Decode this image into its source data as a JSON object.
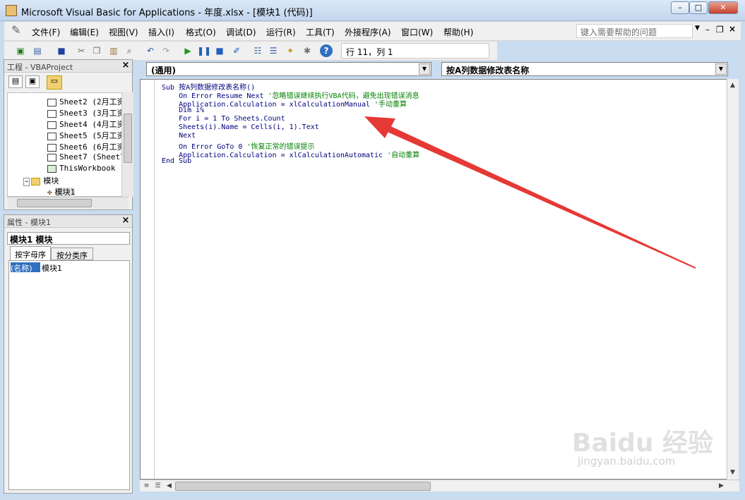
{
  "window": {
    "title": "Microsoft Visual Basic for Applications - 年度.xlsx - [模块1 (代码)]",
    "minimize": "–",
    "maximize": "□",
    "close": "✕"
  },
  "menu": {
    "items": [
      "文件(F)",
      "编辑(E)",
      "视图(V)",
      "插入(I)",
      "格式(O)",
      "调试(D)",
      "运行(R)",
      "工具(T)",
      "外接程序(A)",
      "窗口(W)",
      "帮助(H)"
    ],
    "help_placeholder": "键入需要帮助的问题"
  },
  "toolbar": {
    "position": "行 11，列 1"
  },
  "project": {
    "title": "工程 - VBAProject",
    "items": [
      "Sheet2 (2月工资",
      "Sheet3 (3月工资",
      "Sheet4 (4月工资",
      "Sheet5 (5月工资",
      "Sheet6 (6月工资",
      "Sheet7 (Sheet7",
      "ThisWorkbook"
    ],
    "folder": "模块",
    "module": "模块1"
  },
  "properties": {
    "title": "属性 - 模块1",
    "selector": "模块1 模块",
    "tab_alpha": "按字母序",
    "tab_cat": "按分类序",
    "prop_name": "(名称)",
    "prop_value": "模块1"
  },
  "editor": {
    "object_dropdown": "(通用)",
    "proc_dropdown": "按A列数据修改表名称",
    "lines": [
      {
        "code": "Sub 按A列数据修改表名称()",
        "comment": ""
      },
      {
        "code": "    On Error Resume Next ",
        "comment": "'忽略错误继续执行VBA代码，避免出现错误消息"
      },
      {
        "code": "    Application.Calculation = xlCalculationManual ",
        "comment": "'手动重算"
      },
      {
        "code": "    Dim i%",
        "comment": ""
      },
      {
        "code": "    For i = 1 To Sheets.Count",
        "comment": ""
      },
      {
        "code": "    Sheets(i).Name = Cells(i, 1).Text",
        "comment": ""
      },
      {
        "code": "    Next",
        "comment": ""
      },
      {
        "code": "    On Error GoTo 0 ",
        "comment": "'恢复正常的错误提示"
      },
      {
        "code": "    Application.Calculation = xlCalculationAutomatic ",
        "comment": "'自动重算"
      },
      {
        "code": "End Sub",
        "comment": ""
      }
    ]
  },
  "watermark": {
    "brand": "Baidu 经验",
    "url": "jingyan.baidu.com"
  },
  "colors": {
    "annotation_arrow": "#e53935",
    "code_text": "#000080",
    "comment": "#008000"
  }
}
